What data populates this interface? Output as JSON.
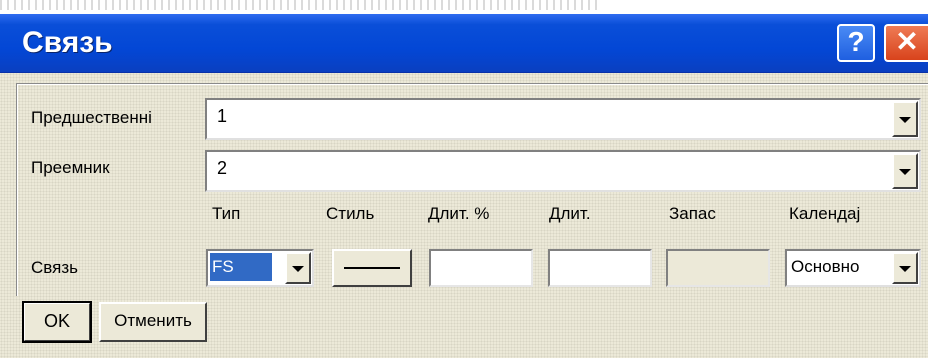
{
  "window": {
    "title": "Связь",
    "help_label": "?",
    "close_label": "✕"
  },
  "predecessor": {
    "label": "Предшественні",
    "value": "1"
  },
  "successor": {
    "label": "Преемник",
    "value": "2"
  },
  "link": {
    "label": "Связь",
    "columns": {
      "type": "Тип",
      "style": "Стиль",
      "lag_pct": "Длит. %",
      "lag": "Длит.",
      "slack": "Запас",
      "calendar": "Календај"
    },
    "type_value": "FS",
    "lag_pct_value": "",
    "lag_value": "",
    "slack_value": "",
    "calendar_value": "Основно"
  },
  "buttons": {
    "ok": "OK",
    "cancel": "Отменить"
  },
  "colors": {
    "title_bar": "#0a4fd8",
    "selection": "#316ac5",
    "close_button": "#d8431c",
    "dialog_bg": "#ece9d8"
  },
  "icons": {
    "help": "question-mark-icon",
    "close": "close-x-icon",
    "dropdown": "chevron-down-icon"
  }
}
